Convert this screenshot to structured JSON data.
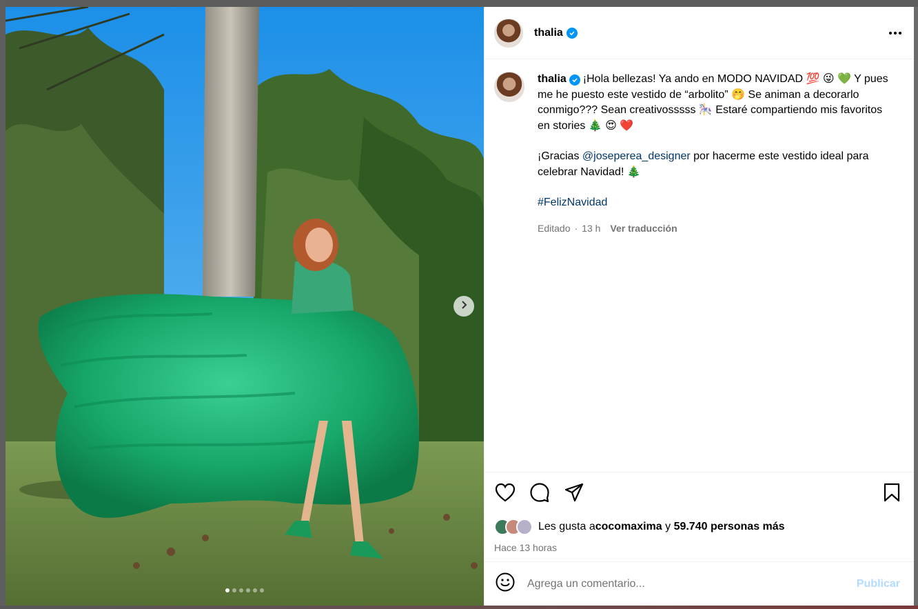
{
  "post": {
    "username": "thalia",
    "verified_icon": "verified-badge-icon",
    "more_icon": "more-horizontal-icon"
  },
  "caption": {
    "username": "thalia",
    "line1": "¡Hola bellezas! Ya ando en MODO NAVIDAD 💯 😜 💚 Y pues me he puesto este vestido de “arbolito” 🤭 Se animan a decorarlo conmigo??? Sean creativosssss 🎠 Estaré compartiendo mis favoritos en stories 🎄 😍 ❤️",
    "thanks_prefix": "¡Gracias ",
    "mention": "@joseperea_designer",
    "thanks_suffix": " por hacerme este vestido ideal para celebrar Navidad!  🎄",
    "hashtag": "#FelizNavidad",
    "edited": "Editado",
    "separator": "·",
    "time": "13 h",
    "translate": "Ver traducción"
  },
  "actions": {
    "like_icon": "heart-icon",
    "comment_icon": "comment-icon",
    "share_icon": "share-icon",
    "save_icon": "bookmark-icon"
  },
  "likes": {
    "prefix": "Les gusta a ",
    "user": "cocomaxima",
    "connector": " y ",
    "others": "59.740 personas más"
  },
  "posted_ago": "Hace 13 horas",
  "comment": {
    "placeholder": "Agrega un comentario...",
    "publish_label": "Publicar",
    "emoji_icon": "emoji-icon"
  },
  "carousel": {
    "next_icon": "chevron-right-icon",
    "slide_count": 6,
    "current_slide": 1
  },
  "colors": {
    "link": "#00376b",
    "verified": "#0095f6",
    "publish_disabled": "#b3dbff",
    "secondary_text": "#737373"
  }
}
